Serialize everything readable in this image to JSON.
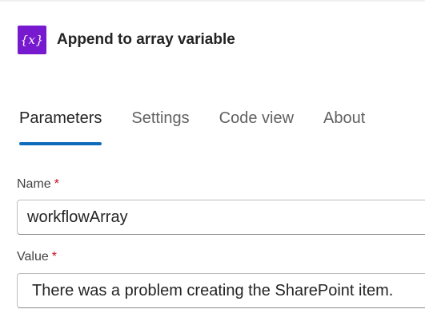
{
  "header": {
    "icon": "variable-braces-icon",
    "icon_glyph": "{x}",
    "icon_color": "#7719cf",
    "title": "Append to array variable"
  },
  "tabs": [
    {
      "label": "Parameters",
      "active": true
    },
    {
      "label": "Settings",
      "active": false
    },
    {
      "label": "Code view",
      "active": false
    },
    {
      "label": "About",
      "active": false
    }
  ],
  "accent_color": "#0f6cbd",
  "required_color": "#c50f1f",
  "fields": {
    "name": {
      "label": "Name",
      "required_marker": "*",
      "value": "workflowArray"
    },
    "value": {
      "label": "Value",
      "required_marker": "*",
      "value": "There was a problem creating the SharePoint item."
    }
  }
}
